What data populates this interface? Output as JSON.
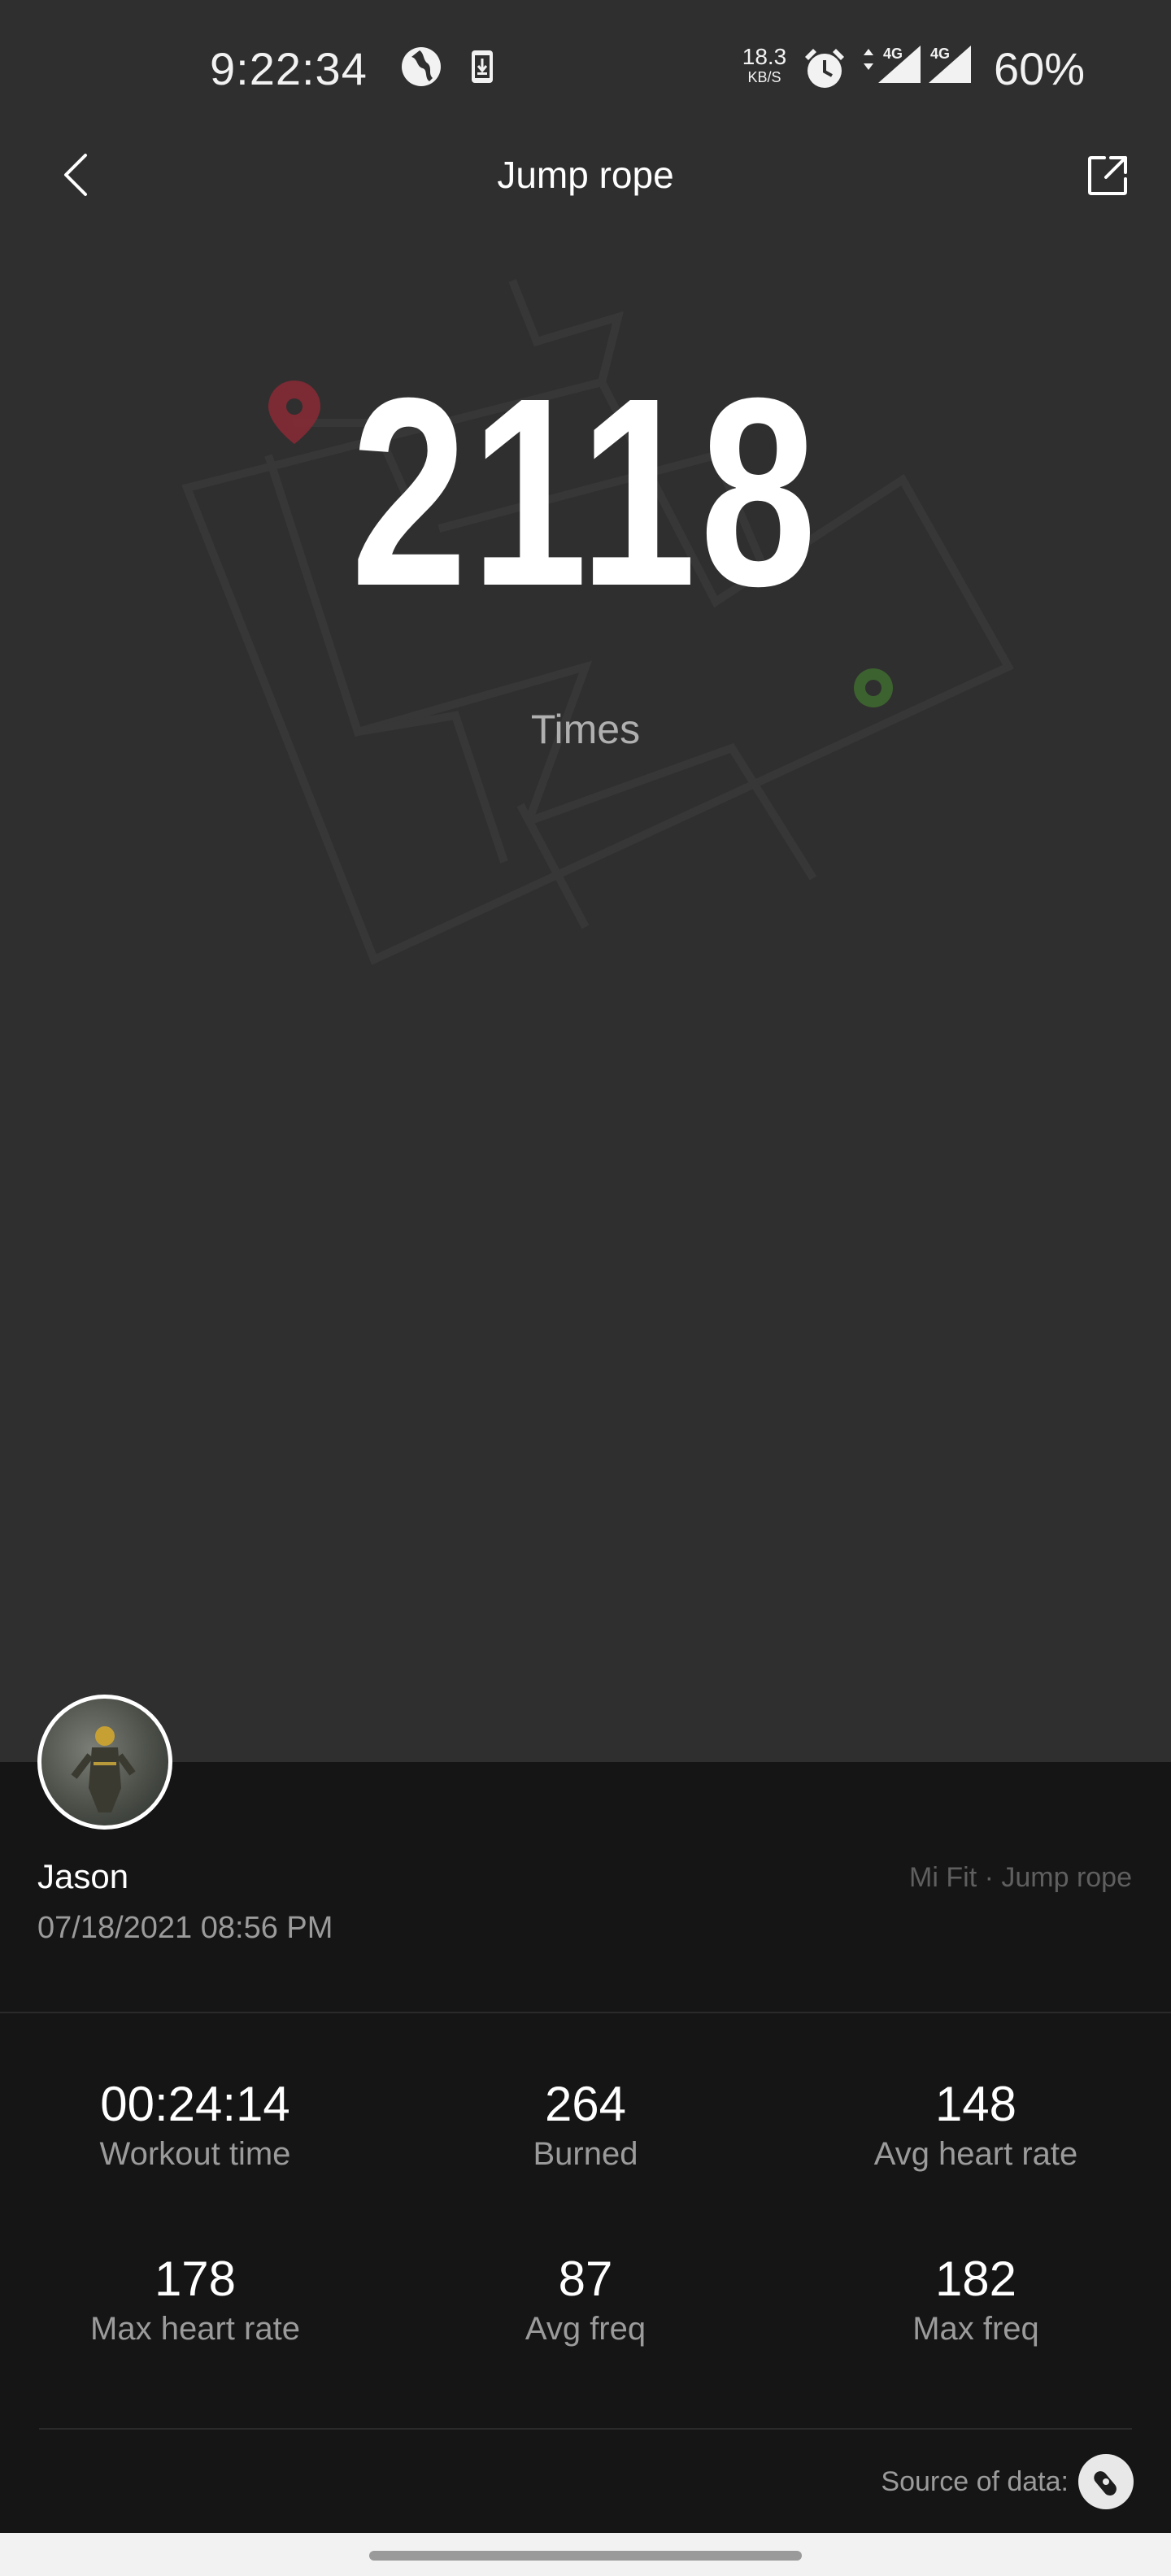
{
  "status_bar": {
    "time": "9:22:34",
    "net_speed_value": "18.3",
    "net_speed_unit": "KB/S",
    "network_label_1": "4G",
    "network_label_2": "4G",
    "battery": "60%"
  },
  "header": {
    "title": "Jump rope",
    "back_icon": "chevron-left-icon",
    "share_icon": "share-icon"
  },
  "summary": {
    "count": "2118",
    "unit": "Times"
  },
  "user": {
    "name": "Jason",
    "datetime": "07/18/2021 08:56 PM",
    "source_app": "Mi Fit · Jump rope"
  },
  "stats": [
    {
      "value": "00:24:14",
      "label": "Workout time"
    },
    {
      "value": "264",
      "label": "Burned"
    },
    {
      "value": "148",
      "label": "Avg heart rate"
    },
    {
      "value": "178",
      "label": "Max heart rate"
    },
    {
      "value": "87",
      "label": "Avg freq"
    },
    {
      "value": "182",
      "label": "Max freq"
    }
  ],
  "footer": {
    "source_label": "Source of data:",
    "source_icon": "band-icon"
  },
  "colors": {
    "background": "#2f2f2f",
    "panel": "#151515",
    "start_marker": "#8a2a35",
    "end_marker": "#3f6b2f"
  }
}
